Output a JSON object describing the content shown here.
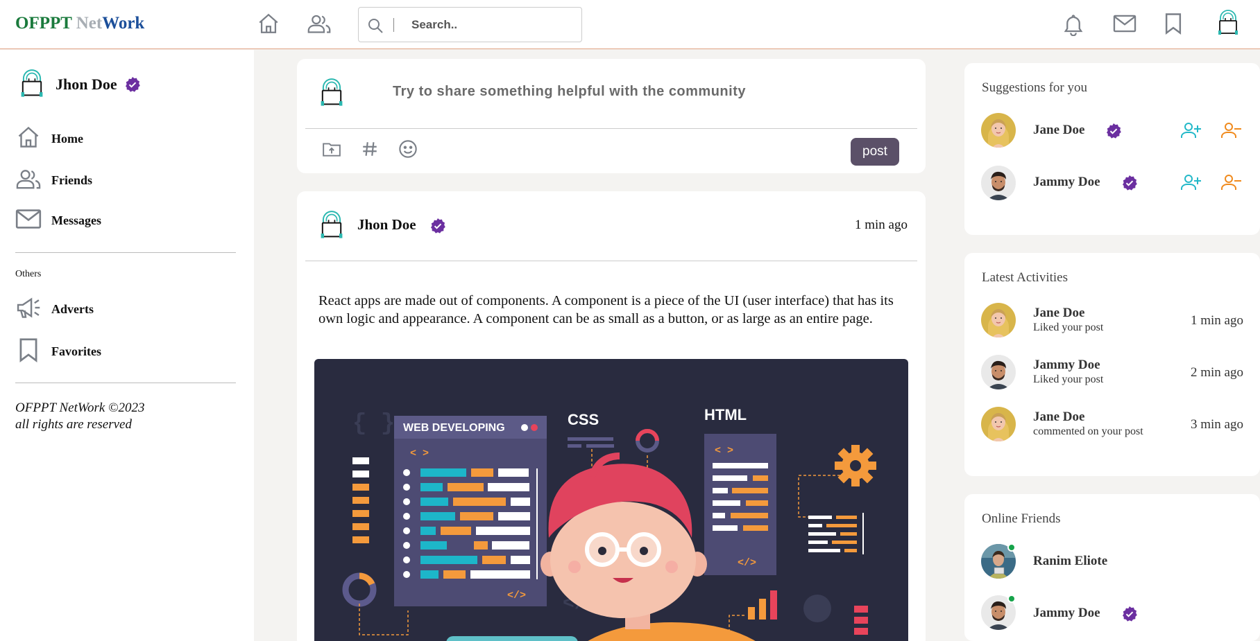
{
  "brand": {
    "part1": "OFPPT ",
    "part2": "Net",
    "part3": "Work"
  },
  "search": {
    "placeholder": "Search.."
  },
  "sidebar": {
    "user_name": "Jhon Doe",
    "items": [
      {
        "label": "Home",
        "icon": "home-icon"
      },
      {
        "label": "Friends",
        "icon": "friends-icon"
      },
      {
        "label": "Messages",
        "icon": "mail-icon"
      }
    ],
    "others_label": "Others",
    "others": [
      {
        "label": "Adverts",
        "icon": "megaphone-icon"
      },
      {
        "label": "Favorites",
        "icon": "bookmark-icon"
      }
    ],
    "footer_line1": "OFPPT NetWork ©2023",
    "footer_line2": "all rights are reserved"
  },
  "composer": {
    "prompt": "Try to share something helpful with the community",
    "post_label": "post"
  },
  "post": {
    "author": "Jhon Doe",
    "time": "1 min ago",
    "text": "React apps are made out of components. A component is a piece of the UI (user interface) that has its own logic and appearance. A component can be as small as a button, or as large as an entire page.",
    "image": {
      "title": "WEB DEVELOPING",
      "css_label": "CSS",
      "html_label": "HTML",
      "code_open": "< >",
      "code_close": "</>"
    }
  },
  "suggestions": {
    "title": "Suggestions for you",
    "people": [
      {
        "name": "Jane Doe",
        "verified": true
      },
      {
        "name": "Jammy Doe",
        "verified": true
      }
    ]
  },
  "activities": {
    "title": "Latest Activities",
    "items": [
      {
        "name": "Jane Doe",
        "action": "Liked your post",
        "time": "1 min ago"
      },
      {
        "name": "Jammy Doe",
        "action": "Liked your post",
        "time": "2 min ago"
      },
      {
        "name": "Jane Doe",
        "action": "commented on your post",
        "time": "3 min ago"
      }
    ]
  },
  "online": {
    "title": "Online Friends",
    "friends": [
      {
        "name": "Ranim Eliote",
        "verified": false
      },
      {
        "name": "Jammy Doe",
        "verified": true
      }
    ]
  },
  "colors": {
    "accent_purple": "#6b2fa0",
    "add_friend": "#22b8c8",
    "remove_friend": "#f08a1c",
    "post_button": "#5b5068",
    "online": "#16a34a"
  }
}
